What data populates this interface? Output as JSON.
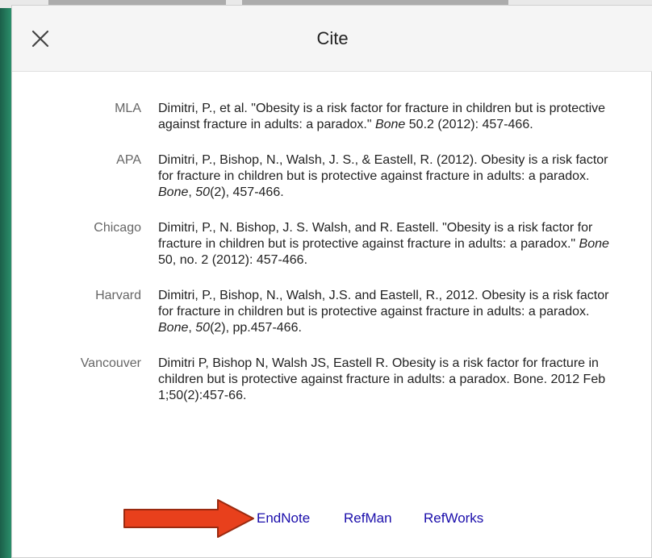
{
  "dialog": {
    "title": "Cite",
    "close_icon": "close-icon"
  },
  "citations": [
    {
      "format": "MLA",
      "parts": [
        {
          "t": "Dimitri, P., et al. \"Obesity is a risk factor for fracture in children but is protective against fracture in adults: a paradox.\" "
        },
        {
          "t": "Bone",
          "i": true
        },
        {
          "t": " 50.2 (2012): 457-466."
        }
      ]
    },
    {
      "format": "APA",
      "parts": [
        {
          "t": "Dimitri, P., Bishop, N., Walsh, J. S., & Eastell, R. (2012). Obesity is a risk factor for fracture in children but is protective against fracture in adults: a paradox. "
        },
        {
          "t": "Bone",
          "i": true
        },
        {
          "t": ", "
        },
        {
          "t": "50",
          "i": true
        },
        {
          "t": "(2), 457-466."
        }
      ]
    },
    {
      "format": "Chicago",
      "parts": [
        {
          "t": "Dimitri, P., N. Bishop, J. S. Walsh, and R. Eastell. \"Obesity is a risk factor for fracture in children but is protective against fracture in adults: a paradox.\" "
        },
        {
          "t": "Bone",
          "i": true
        },
        {
          "t": " 50, no. 2 (2012): 457-466."
        }
      ]
    },
    {
      "format": "Harvard",
      "parts": [
        {
          "t": "Dimitri, P., Bishop, N., Walsh, J.S. and Eastell, R., 2012. Obesity is a risk factor for fracture in children but is protective against fracture in adults: a paradox. "
        },
        {
          "t": "Bone",
          "i": true
        },
        {
          "t": ", "
        },
        {
          "t": "50",
          "i": true
        },
        {
          "t": "(2), pp.457-466."
        }
      ]
    },
    {
      "format": "Vancouver",
      "parts": [
        {
          "t": "Dimitri P, Bishop N, Walsh JS, Eastell R. Obesity is a risk factor for fracture in children but is protective against fracture in adults: a paradox. Bone. 2012 Feb 1;50(2):457-66."
        }
      ]
    }
  ],
  "export_links": {
    "endnote": "EndNote",
    "refman": "RefMan",
    "refworks": "RefWorks"
  },
  "annotation": {
    "arrow_icon": "right-arrow-icon",
    "arrow_color": "#e8401c",
    "arrow_outline": "#9a2a10"
  },
  "colors": {
    "link": "#1a0dab",
    "format_label": "#666666",
    "header_bg": "#f5f5f5",
    "backdrop": "#2f9e76"
  }
}
